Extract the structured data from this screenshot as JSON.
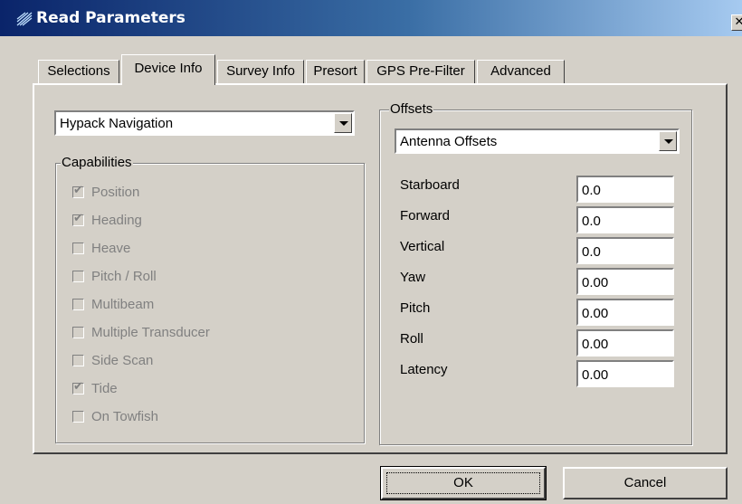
{
  "window": {
    "title": "Read Parameters",
    "close_glyph": "✕"
  },
  "tabs": [
    {
      "label": "Selections"
    },
    {
      "label": "Device Info"
    },
    {
      "label": "Survey Info"
    },
    {
      "label": "Presort"
    },
    {
      "label": "GPS Pre-Filter"
    },
    {
      "label": "Advanced"
    }
  ],
  "device_select": {
    "value": "Hypack Navigation"
  },
  "capabilities": {
    "label": "Capabilities",
    "items": [
      {
        "label": "Position",
        "checked": true
      },
      {
        "label": "Heading",
        "checked": true
      },
      {
        "label": "Heave",
        "checked": false
      },
      {
        "label": "Pitch / Roll",
        "checked": false
      },
      {
        "label": "Multibeam",
        "checked": false
      },
      {
        "label": "Multiple Transducer",
        "checked": false
      },
      {
        "label": "Side Scan",
        "checked": false
      },
      {
        "label": "Tide",
        "checked": true
      },
      {
        "label": "On Towfish",
        "checked": false
      }
    ]
  },
  "offsets": {
    "label": "Offsets",
    "select_value": "Antenna Offsets",
    "fields": [
      {
        "label": "Starboard",
        "value": "0.0"
      },
      {
        "label": "Forward",
        "value": "0.0"
      },
      {
        "label": "Vertical",
        "value": "0.0"
      },
      {
        "label": "Yaw",
        "value": "0.00"
      },
      {
        "label": "Pitch",
        "value": "0.00"
      },
      {
        "label": "Roll",
        "value": "0.00"
      },
      {
        "label": "Latency",
        "value": "0.00"
      }
    ]
  },
  "buttons": {
    "ok": "OK",
    "cancel": "Cancel"
  },
  "colors": {
    "titlebar_start": "#0a246a",
    "titlebar_end": "#a6caf0",
    "face": "#d4d0c8"
  }
}
